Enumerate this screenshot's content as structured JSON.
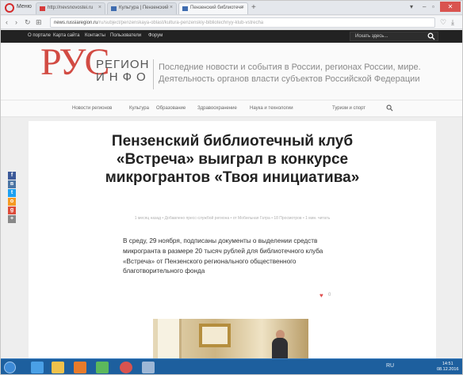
{
  "browser": {
    "menu_label": "Меню",
    "tabs": [
      {
        "label": "http://nevsnovostei.ru"
      },
      {
        "label": "Культура | Пензенский"
      },
      {
        "label": "Пензенский библиотечн"
      }
    ],
    "url": "news.russiaregion.ru",
    "url_tail": "/ru/subject/penzenskaya-oblast/kultura-penzenskiy-bibliotechnyy-klub-vstrecha"
  },
  "site": {
    "top_links": [
      "О портале",
      "Карта сайта",
      "Контакты",
      "Пользователи",
      "Форум"
    ],
    "search_placeholder": "Искать здесь...",
    "logo": {
      "ru": "РУС",
      "region": "РЕГИОН",
      "info": "ИНФО"
    },
    "tagline_line1": "Последние новости и события в России, регионах России, мире.",
    "tagline_line2": "Деятельность органов власти субъектов Российской Федерации",
    "nav": [
      "Новости регионов",
      "Культура",
      "Образование",
      "Здравоохранение",
      "Наука и технологии",
      "Туризм и спорт"
    ]
  },
  "article": {
    "title": "Пензенский библиотечный клуб «Встреча» выиграл в конкурсе микрогрантов «Твоя инициатива»",
    "meta": "1 месяц назад • Добавлено пресс-службой региона • от Мобильная Гатра • 18 Просмотров • 1 мин. читать",
    "lead": "В среду, 29 ноября, подписаны документы о выделении средств микрогранта в размере 20 тысяч рублей для библиотечного клуба «Встреча» от Пензенского регионального общественного благотворительного фонда",
    "likes": "0"
  },
  "social": [
    {
      "name": "facebook",
      "color": "#3b5998",
      "glyph": "f"
    },
    {
      "name": "vk",
      "color": "#4c75a3",
      "glyph": "в"
    },
    {
      "name": "twitter",
      "color": "#1da1f2",
      "glyph": "t"
    },
    {
      "name": "odnoklassniki",
      "color": "#f59a23",
      "glyph": "о"
    },
    {
      "name": "google-plus",
      "color": "#dd4b39",
      "glyph": "g"
    },
    {
      "name": "more",
      "color": "#888888",
      "glyph": "+"
    }
  ],
  "taskbar": {
    "tray": "RU",
    "time": "14:51",
    "date": "08.12.2016"
  }
}
